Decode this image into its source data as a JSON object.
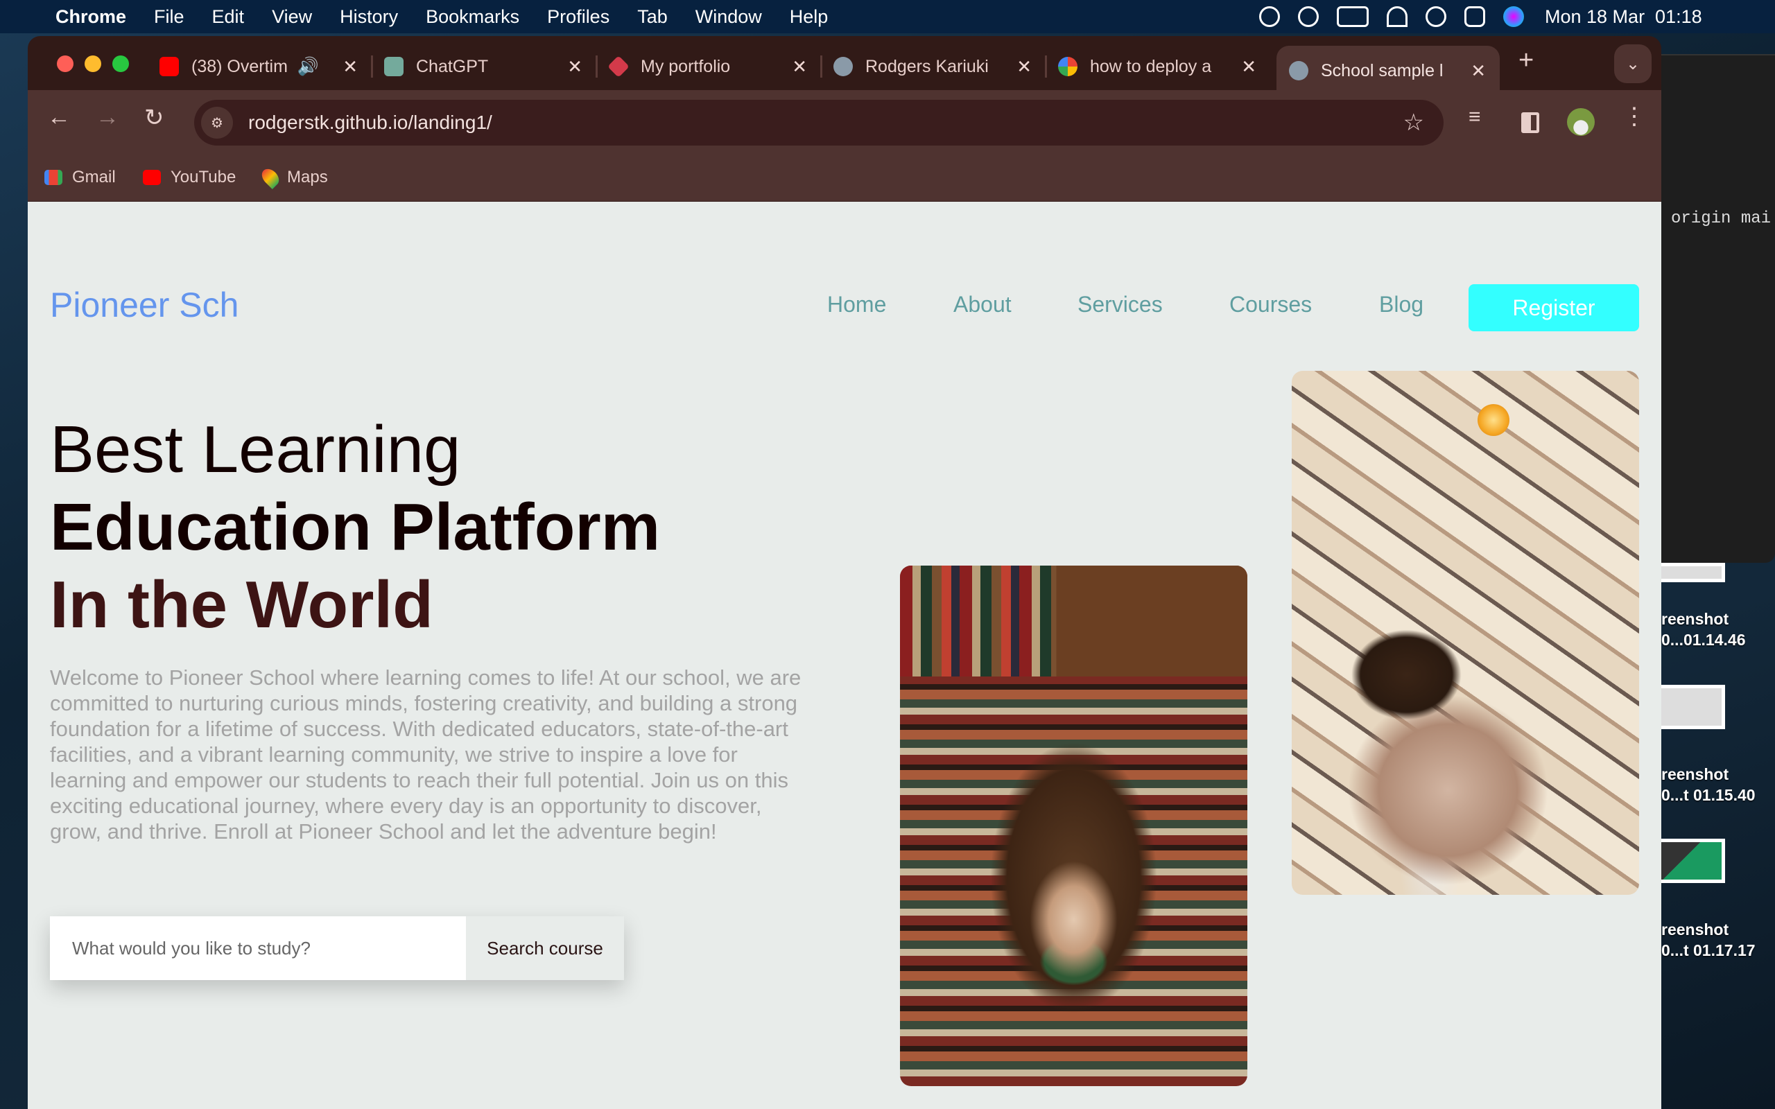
{
  "menubar": {
    "app": "Chrome",
    "items": [
      "File",
      "Edit",
      "View",
      "History",
      "Bookmarks",
      "Profiles",
      "Tab",
      "Window",
      "Help"
    ],
    "clock": "Mon 18 Mar  01:18"
  },
  "tabs": [
    {
      "title": "(38) Overtim",
      "icon": "youtube-icon"
    },
    {
      "title": "ChatGPT",
      "icon": "chatgpt-icon"
    },
    {
      "title": "My portfolio",
      "icon": "dice-icon"
    },
    {
      "title": "Rodgers Kariuki",
      "icon": "globe-icon"
    },
    {
      "title": "how to deploy a",
      "icon": "google-icon"
    },
    {
      "title": "School sample l",
      "icon": "globe-icon",
      "active": true
    }
  ],
  "toolbar": {
    "url": "rodgerstk.github.io/landing1/"
  },
  "bookmarks": [
    {
      "label": "Gmail"
    },
    {
      "label": "YouTube"
    },
    {
      "label": "Maps"
    }
  ],
  "site": {
    "logo": "Pioneer Sch",
    "nav": [
      "Home",
      "About",
      "Services",
      "Courses",
      "Blog"
    ],
    "register": "Register",
    "heading": [
      "Best Learning",
      "Education Platform",
      "In the World"
    ],
    "paragraph": "Welcome to Pioneer School where learning comes to life! At our school, we are committed to nurturing curious minds, fostering creativity, and building a strong foundation for a lifetime of success. With dedicated educators, state-of-the-art facilities, and a vibrant learning community, we strive to inspire a love for learning and empower our students to reach their full potential. Join us on this exciting educational journey, where every day is an opportunity to discover, grow, and thrive. Enroll at Pioneer School and let the adventure begin!",
    "search_placeholder": "What would you like to study?",
    "search_button": "Search course",
    "colors": {
      "logo": "#6495ed",
      "nav": "#5f9ea0",
      "register": "#33ffff",
      "heading3": "#3d1414"
    }
  },
  "desktop": {
    "terminal_text": "origin mai",
    "screenshots": [
      {
        "line1": "reenshot",
        "line2": "0...01.14.46"
      },
      {
        "line1": "reenshot",
        "line2": "0...t 01.15.40"
      },
      {
        "line1": "reenshot",
        "line2": "0...t 01.17.17"
      }
    ]
  }
}
